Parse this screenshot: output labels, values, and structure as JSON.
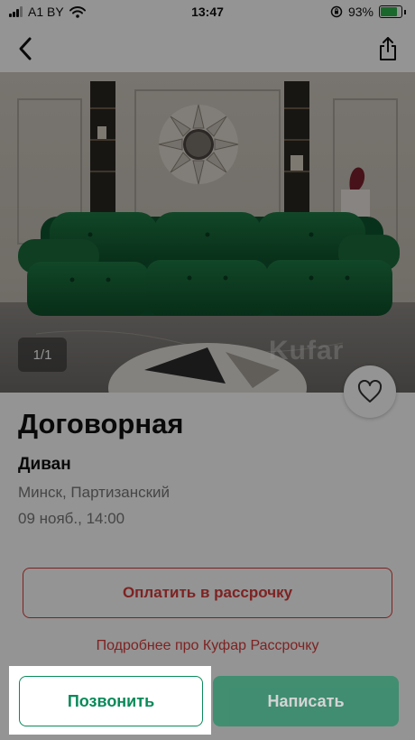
{
  "status_bar": {
    "carrier": "A1 BY",
    "time": "13:47",
    "battery_percent": "93%",
    "battery_level": 0.93
  },
  "nav": {
    "back_icon": "chevron-left-icon",
    "share_icon": "share-icon"
  },
  "gallery": {
    "counter": "1/1",
    "watermark": "Kufar"
  },
  "listing": {
    "price": "Договорная",
    "title": "Диван",
    "location": "Минск, Партизанский",
    "date": "09 нояб., 14:00"
  },
  "actions": {
    "installment_button": "Оплатить в рассрочку",
    "installment_link": "Подробнее про Куфар Рассрочку",
    "call_button": "Позвонить",
    "write_button": "Написать"
  },
  "colors": {
    "accent_green": "#0a8a5a",
    "accent_red": "#d93b3b"
  }
}
